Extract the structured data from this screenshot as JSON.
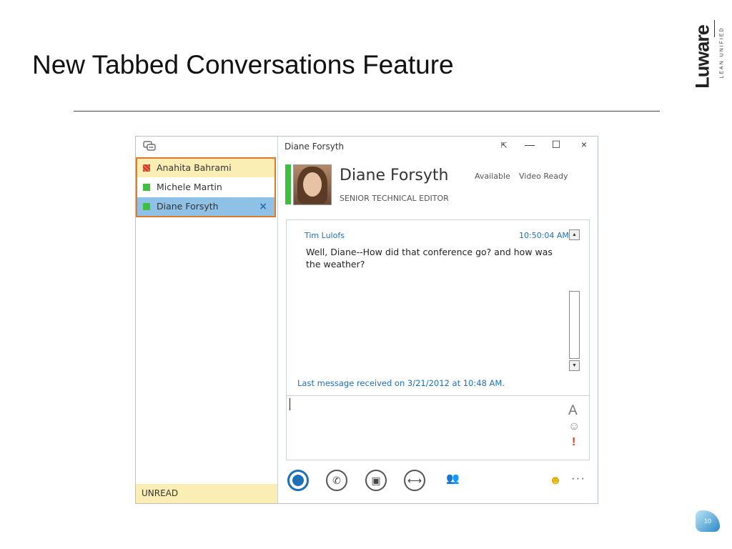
{
  "slide": {
    "title": "New Tabbed Conversations Feature",
    "page_number": "10"
  },
  "logo": {
    "brand": "Luware",
    "tagline": "LEAN UNIFIED"
  },
  "sidebar": {
    "tabs": [
      {
        "name": "Anahita Bahrami",
        "status": "busy"
      },
      {
        "name": "Michele Martin",
        "status": "available"
      },
      {
        "name": "Diane Forsyth",
        "status": "available",
        "selected": true,
        "close": "×"
      }
    ],
    "unread_label": "UNREAD"
  },
  "window": {
    "title": "Diane Forsyth",
    "controls": {
      "popout": "⇱",
      "minimize": "—",
      "maximize": "☐",
      "close": "×"
    }
  },
  "contact": {
    "name": "Diane Forsyth",
    "title": "SENIOR TECHNICAL EDITOR",
    "availability": "Available",
    "video": "Video Ready"
  },
  "conversation": {
    "messages": [
      {
        "sender": "Tim Lulofs",
        "time": "10:50:04 AM",
        "text": "Well, Diane--How did that conference go?  and how was the weather?"
      }
    ],
    "last_message_info": "Last message received on 3/21/2012 at 10:48 AM."
  },
  "compose": {
    "font_label": "A",
    "emoticon": "☺",
    "important": "!"
  },
  "toolbar": {
    "phone": "✆",
    "video": "▣",
    "share": "⟷",
    "people": "👥",
    "emoji": "☻",
    "more": "···"
  },
  "colors": {
    "accent": "#1e6fb6",
    "available": "#3fbf3f",
    "busy": "#c8371f",
    "highlight_border": "#e07a2a",
    "selected_tab": "#8fc0e6",
    "unread_bg": "#fbeeb5"
  }
}
